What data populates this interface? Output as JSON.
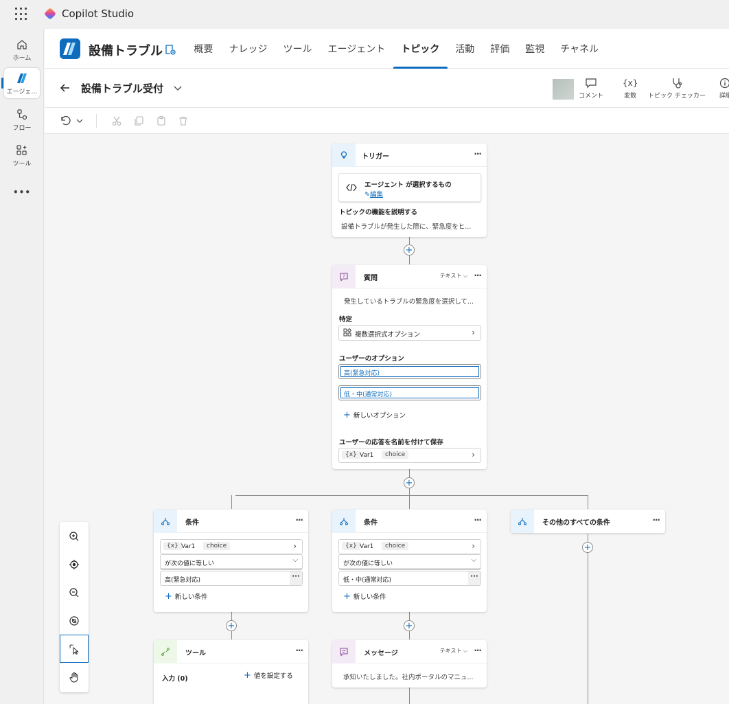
{
  "app": {
    "title": "Copilot Studio"
  },
  "rail": {
    "items": [
      {
        "label": "ホーム",
        "icon": "home-icon"
      },
      {
        "label": "エージェ…",
        "icon": "agent-icon"
      },
      {
        "label": "フロー",
        "icon": "flow-icon"
      },
      {
        "label": "ツール",
        "icon": "tools-icon"
      }
    ],
    "more": "•••"
  },
  "header": {
    "agent_name": "設備トラブル",
    "tabs": [
      "概要",
      "ナレッジ",
      "ツール",
      "エージェント",
      "トピック",
      "活動",
      "評価",
      "監視",
      "チャネル"
    ],
    "active_tab": "トピック"
  },
  "topic": {
    "name": "設備トラブル受付",
    "actions": [
      "コメント",
      "変数",
      "トピック チェッカー",
      "詳細"
    ]
  },
  "nodes": {
    "trigger": {
      "title": "トリガー",
      "more": "···",
      "selector_title": "エージェント が選択するもの",
      "edit": "編集",
      "desc_label": "トピックの機能を説明する",
      "desc_text": "設備トラブルが発生した際に、緊急度をヒ..."
    },
    "question": {
      "title": "質問",
      "type": "テキスト",
      "more": "···",
      "prompt": "発生しているトラブルの緊急度を選択して...",
      "identify_label": "特定",
      "identify_value": "複数選択式オプション",
      "options_label": "ユーザーのオプション",
      "options": [
        "高(緊急対応)",
        "低・中(通常対応)"
      ],
      "new_option": "新しいオプション",
      "save_label": "ユーザーの応答を名前を付けて保存",
      "var_icon": "{x}",
      "var_name": "Var1",
      "var_type": "choice"
    },
    "cond1": {
      "title": "条件",
      "more": "···",
      "var_icon": "{x}",
      "var_name": "Var1",
      "var_type": "choice",
      "operator": "が次の値に等しい",
      "value": "高(緊急対応)",
      "value_more": "···",
      "new_condition": "新しい条件"
    },
    "cond2": {
      "title": "条件",
      "more": "···",
      "var_icon": "{x}",
      "var_name": "Var1",
      "var_type": "choice",
      "operator": "が次の値に等しい",
      "value": "低・中(通常対応)",
      "value_more": "···",
      "new_condition": "新しい条件"
    },
    "cond_else": {
      "title": "その他のすべての条件",
      "more": "···"
    },
    "tool": {
      "title": "ツール",
      "more": "···",
      "input_label": "入力 (0)",
      "set_value": "値を設定する"
    },
    "message": {
      "title": "メッセージ",
      "type": "テキスト",
      "more": "···",
      "text": "承知いたしました。社内ポータルのマニュ..."
    }
  },
  "colors": {
    "accent": "#0f6cbd",
    "trigger_bg": "#e8f3fc",
    "question_bg": "#f3ecf6",
    "condition_bg": "#e8f3fc",
    "tool_bg": "#eef8e8",
    "message_bg": "#f3ecf6"
  }
}
